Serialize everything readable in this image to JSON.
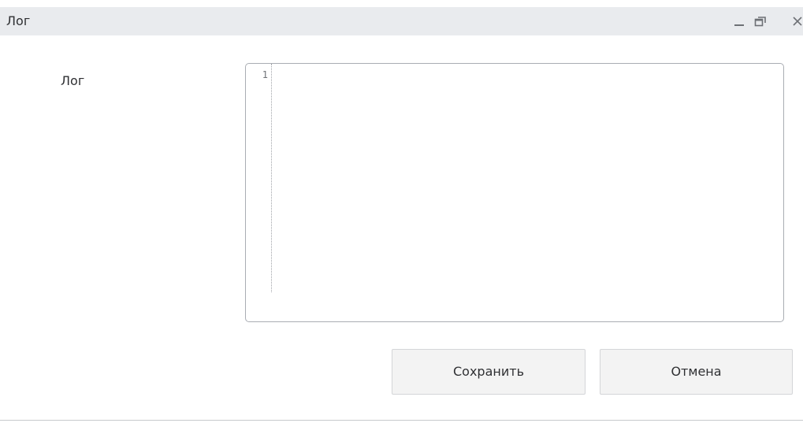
{
  "window": {
    "title": "Лог",
    "controls": {
      "minimize_icon": "minimize-icon",
      "maximize_icon": "restore-icon",
      "close_icon": "close-icon",
      "minimize_glyph": "_",
      "close_glyph": "×"
    }
  },
  "form": {
    "field_label": "Лог",
    "editor": {
      "line_numbers": [
        "1"
      ],
      "content": ""
    }
  },
  "buttons": {
    "save_label": "Сохранить",
    "cancel_label": "Отмена"
  },
  "colors": {
    "titlebar_bg": "#e9ebee",
    "button_bg": "#f3f3f3",
    "editor_border": "#a9adb3"
  }
}
